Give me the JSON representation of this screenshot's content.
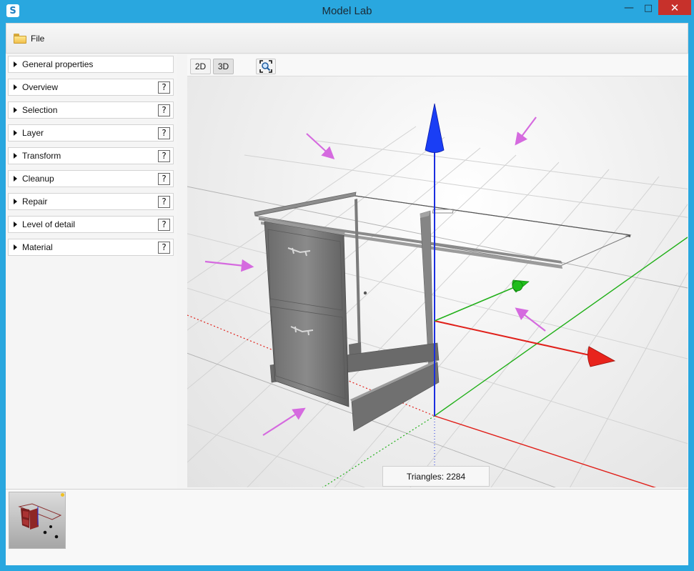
{
  "window": {
    "title": "Model Lab",
    "icon": "model-lab-app-icon"
  },
  "menu": {
    "file_label": "File",
    "file_icon": "folder-icon"
  },
  "panel": {
    "items": [
      {
        "label": "General properties",
        "help": false
      },
      {
        "label": "Overview",
        "help": true
      },
      {
        "label": "Selection",
        "help": true
      },
      {
        "label": "Layer",
        "help": true
      },
      {
        "label": "Transform",
        "help": true
      },
      {
        "label": "Cleanup",
        "help": true
      },
      {
        "label": "Repair",
        "help": true
      },
      {
        "label": "Level of detail",
        "help": true
      },
      {
        "label": "Material",
        "help": true
      }
    ],
    "help_glyph": "?"
  },
  "viewport_toolbar": {
    "btn_2d": "2D",
    "btn_3d": "3D",
    "active_mode": "3D",
    "zoom_icon": "zoom-fit-icon"
  },
  "status": {
    "triangles": "Triangles: 2284"
  },
  "colors": {
    "axis_x": "#e0201a",
    "axis_y": "#1a2ee0",
    "axis_z": "#22b01a",
    "annotation_arrows": "#d56adf",
    "titlebar": "#29a7df",
    "close_button": "#c7312b"
  }
}
